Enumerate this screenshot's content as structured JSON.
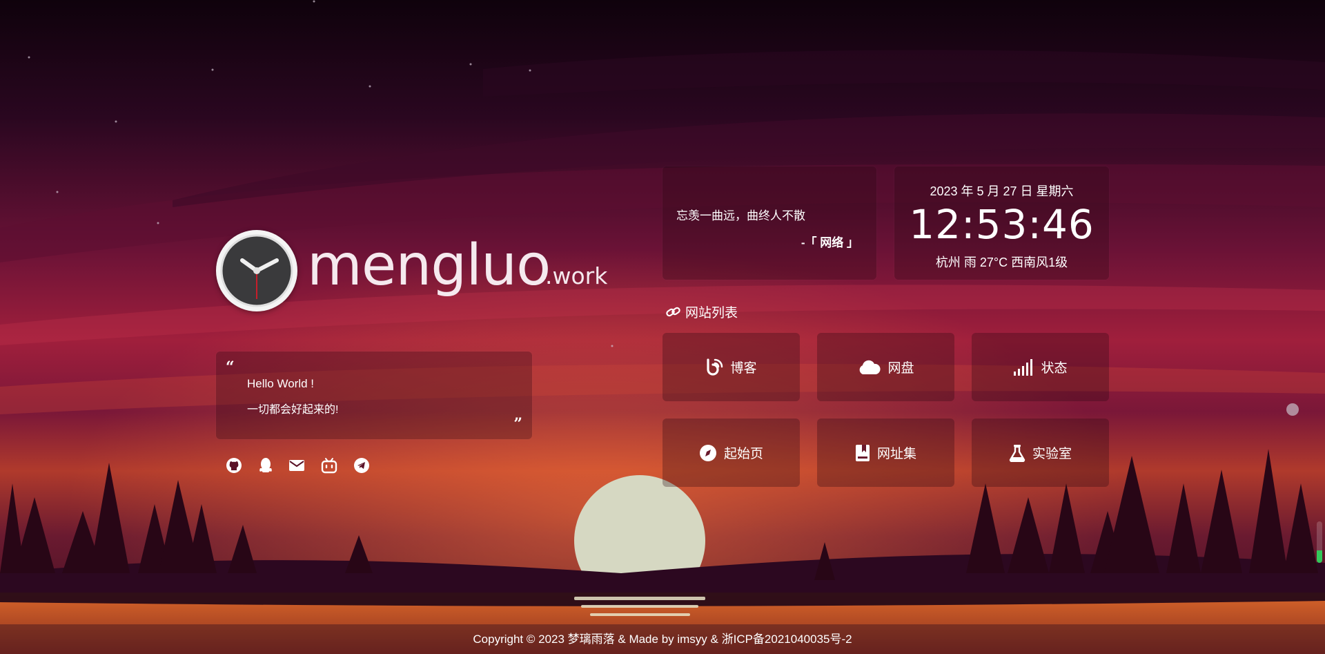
{
  "brand": {
    "name": "mengluo",
    "suffix": ".work",
    "avatar_icon": "clock-icon"
  },
  "quote": {
    "line1": "Hello World !",
    "line2": "一切都会好起来的!"
  },
  "social": [
    {
      "name": "github-icon"
    },
    {
      "name": "qq-icon"
    },
    {
      "name": "mail-icon"
    },
    {
      "name": "bilibili-icon"
    },
    {
      "name": "telegram-icon"
    }
  ],
  "poem": {
    "text": "忘羡一曲远，曲终人不散",
    "source": "-「 网络 」"
  },
  "time": {
    "date": "2023 年 5 月 27 日 星期六",
    "clock": "12:53:46",
    "weather": "杭州 雨 27°C 西南风1级"
  },
  "sites": {
    "heading": "网站列表",
    "items": [
      {
        "label": "博客",
        "icon": "blog-icon"
      },
      {
        "label": "网盘",
        "icon": "cloud-icon"
      },
      {
        "label": "状态",
        "icon": "signal-icon"
      },
      {
        "label": "起始页",
        "icon": "compass-icon"
      },
      {
        "label": "网址集",
        "icon": "bookmark-icon"
      },
      {
        "label": "实验室",
        "icon": "flask-icon"
      }
    ]
  },
  "volume": {
    "level": 0.3
  },
  "footer": {
    "text": "Copyright © 2023 梦璃雨落 & Made by imsyy & 浙ICP备2021040035号-2"
  },
  "colors": {
    "sky_top": "#140410",
    "sky_mid": "#9a1e3c",
    "sun": "#d8d8c4",
    "lake": "#c2541f"
  }
}
